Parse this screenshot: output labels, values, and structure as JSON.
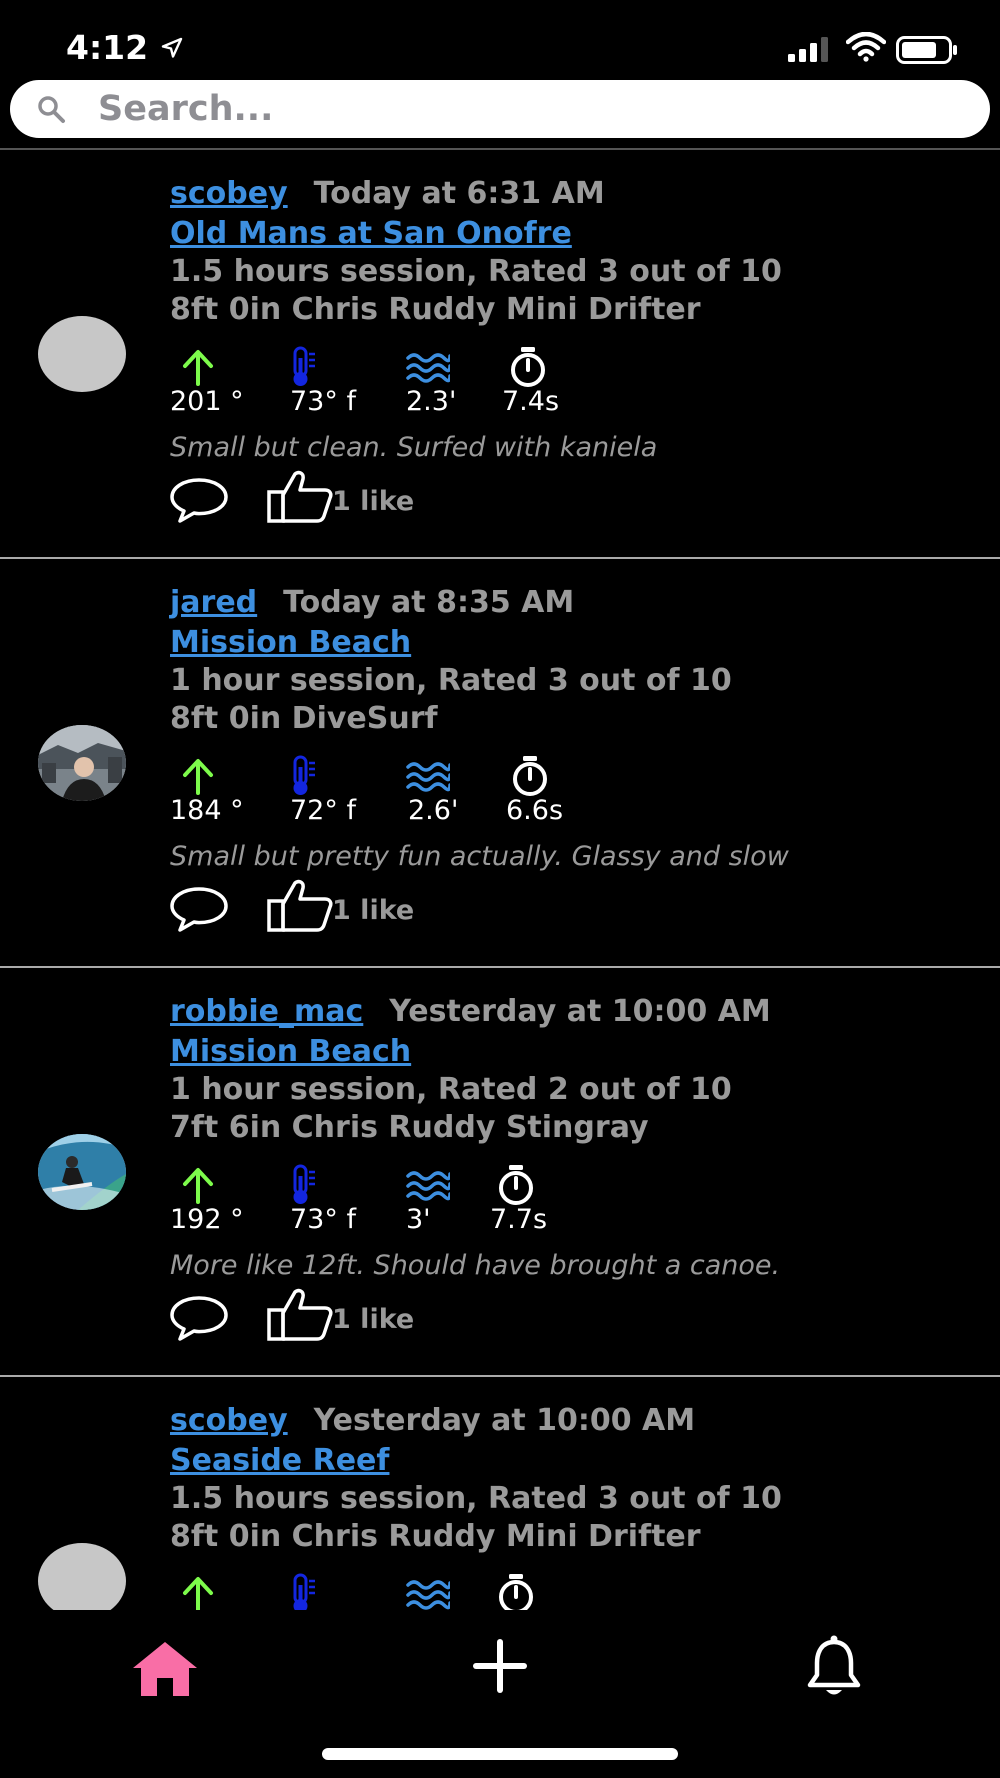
{
  "status_bar": {
    "time": "4:12"
  },
  "search": {
    "placeholder": "Search..."
  },
  "posts": [
    {
      "username": "scobey",
      "timestamp": "Today at 6:31 AM",
      "spot": "Old Mans at San Onofre",
      "session": "1.5 hours session, Rated 3 out of 10",
      "board": "8ft 0in Chris Ruddy Mini Drifter",
      "direction": "201 °",
      "temp": "73° f",
      "height": "2.3'",
      "period": "7.4s",
      "note": "Small but clean. Surfed with kaniela",
      "likes": "1 like",
      "avatar": "placeholder"
    },
    {
      "username": "jared",
      "timestamp": "Today at 8:35 AM",
      "spot": "Mission Beach",
      "session": "1 hour session, Rated 3 out of 10",
      "board": "8ft 0in DiveSurf",
      "direction": "184 °",
      "temp": "72° f",
      "height": "2.6'",
      "period": "6.6s",
      "note": "Small but pretty fun actually. Glassy and slow",
      "likes": "1 like",
      "avatar": "photo"
    },
    {
      "username": "robbie_mac",
      "timestamp": "Yesterday at 10:00 AM",
      "spot": "Mission Beach",
      "session": "1 hour session, Rated 2 out of 10",
      "board": "7ft 6in Chris Ruddy Stingray",
      "direction": "192 °",
      "temp": "73° f",
      "height": "3'",
      "period": "7.7s",
      "note": "More like 12ft. Should have brought a canoe.",
      "likes": "1 like",
      "avatar": "photo"
    },
    {
      "username": "scobey",
      "timestamp": "Yesterday at 10:00 AM",
      "spot": "Seaside Reef",
      "session": "1.5 hours session, Rated 3 out of 10",
      "board": "8ft 0in Chris Ruddy Mini Drifter",
      "avatar": "placeholder"
    }
  ],
  "icons": {
    "direction": "arrow-up-icon",
    "temperature": "thermometer-icon",
    "wave": "wave-icon",
    "period": "stopwatch-icon",
    "comment": "comment-icon",
    "like": "thumbs-up-icon"
  },
  "tab_bar": {
    "active_tab": "home",
    "items": [
      "home",
      "add",
      "notifications"
    ]
  },
  "colors": {
    "background": "#000000",
    "link": "#3d8fe0",
    "muted_text": "#9a9a9a",
    "arrow": "#7dfb4b",
    "thermometer": "#1326e0",
    "wave": "#3d8fe0",
    "active_tab": "#f96ea6"
  }
}
